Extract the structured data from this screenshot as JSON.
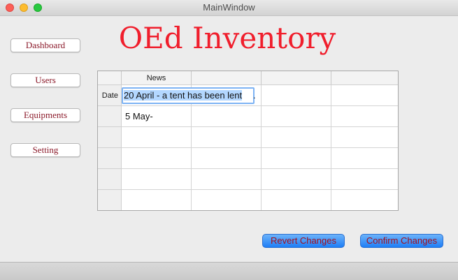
{
  "window": {
    "title": "MainWindow"
  },
  "app": {
    "title": "OEd Inventory",
    "title_color": "#f01e2c"
  },
  "sidebar": {
    "items": [
      {
        "label": "Dashboard"
      },
      {
        "label": "Users"
      },
      {
        "label": "Equipments"
      },
      {
        "label": "Setting"
      }
    ]
  },
  "table": {
    "columns": [
      "News",
      "",
      "",
      ""
    ],
    "row_headers": [
      "Date",
      "",
      "",
      "",
      "",
      ""
    ],
    "rows": [
      [
        "",
        "",
        "",
        ""
      ],
      [
        "5 May-",
        "",
        "",
        ""
      ],
      [
        "",
        "",
        "",
        ""
      ],
      [
        "",
        "",
        "",
        ""
      ],
      [
        "",
        "",
        "",
        ""
      ],
      [
        "",
        "",
        "",
        ""
      ]
    ],
    "editing_cell_value": "20 April - a tent has been lent",
    "editing_overflow_marker": "."
  },
  "actions": {
    "revert_label": "Revert Changes",
    "confirm_label": "Confirm Changes"
  },
  "icons": {
    "close": "close-traffic-light-icon",
    "minimize": "minimize-traffic-light-icon",
    "maximize": "maximize-traffic-light-icon"
  }
}
